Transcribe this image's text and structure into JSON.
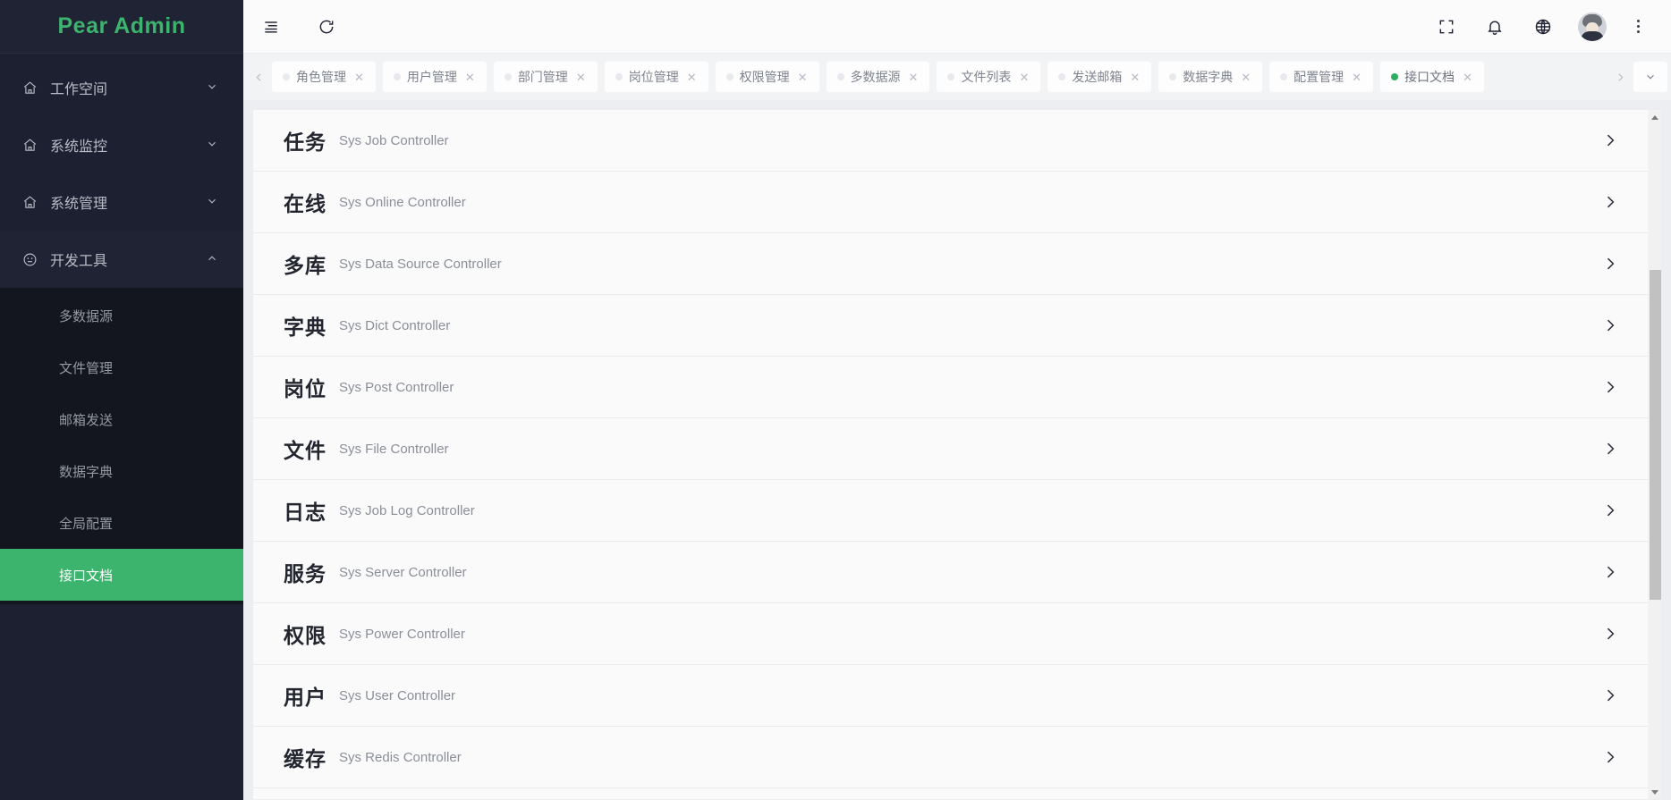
{
  "brand": {
    "title": "Pear Admin"
  },
  "sidebar": {
    "groups": [
      {
        "label": "工作空间",
        "icon": "home-icon",
        "open": false
      },
      {
        "label": "系统监控",
        "icon": "home-icon",
        "open": false
      },
      {
        "label": "系统管理",
        "icon": "home-icon",
        "open": false
      },
      {
        "label": "开发工具",
        "icon": "dev-tools-icon",
        "open": true
      }
    ],
    "submenu": [
      {
        "label": "多数据源",
        "active": false
      },
      {
        "label": "文件管理",
        "active": false
      },
      {
        "label": "邮箱发送",
        "active": false
      },
      {
        "label": "数据字典",
        "active": false
      },
      {
        "label": "全局配置",
        "active": false
      },
      {
        "label": "接口文档",
        "active": true
      }
    ]
  },
  "topbar": {
    "menu_toggle": "menu-icon",
    "refresh": "refresh-icon",
    "fullscreen": "fullscreen-icon",
    "notification": "bell-icon",
    "language": "globe-icon",
    "avatar": "user-avatar",
    "more": "more-vertical-icon"
  },
  "tabbar": {
    "prev_label": "‹",
    "next_label": "›",
    "close_label": "✕",
    "tabs": [
      {
        "label": "角色管理",
        "active": false
      },
      {
        "label": "用户管理",
        "active": false
      },
      {
        "label": "部门管理",
        "active": false
      },
      {
        "label": "岗位管理",
        "active": false
      },
      {
        "label": "权限管理",
        "active": false
      },
      {
        "label": "多数据源",
        "active": false
      },
      {
        "label": "文件列表",
        "active": false
      },
      {
        "label": "发送邮箱",
        "active": false
      },
      {
        "label": "数据字典",
        "active": false
      },
      {
        "label": "配置管理",
        "active": false
      },
      {
        "label": "接口文档",
        "active": true
      }
    ]
  },
  "content": {
    "rows": [
      {
        "title": "任务",
        "subtitle": "Sys Job Controller"
      },
      {
        "title": "在线",
        "subtitle": "Sys Online Controller"
      },
      {
        "title": "多库",
        "subtitle": "Sys Data Source Controller"
      },
      {
        "title": "字典",
        "subtitle": "Sys Dict Controller"
      },
      {
        "title": "岗位",
        "subtitle": "Sys Post Controller"
      },
      {
        "title": "文件",
        "subtitle": "Sys File Controller"
      },
      {
        "title": "日志",
        "subtitle": "Sys Job Log Controller"
      },
      {
        "title": "服务",
        "subtitle": "Sys Server Controller"
      },
      {
        "title": "权限",
        "subtitle": "Sys Power Controller"
      },
      {
        "title": "用户",
        "subtitle": "Sys User Controller"
      },
      {
        "title": "缓存",
        "subtitle": "Sys Redis Controller"
      }
    ]
  },
  "colors": {
    "accent": "#3cb46e",
    "sidebar_bg": "#1d2030",
    "submenu_bg": "#14161f",
    "content_bg": "#fafafb"
  }
}
